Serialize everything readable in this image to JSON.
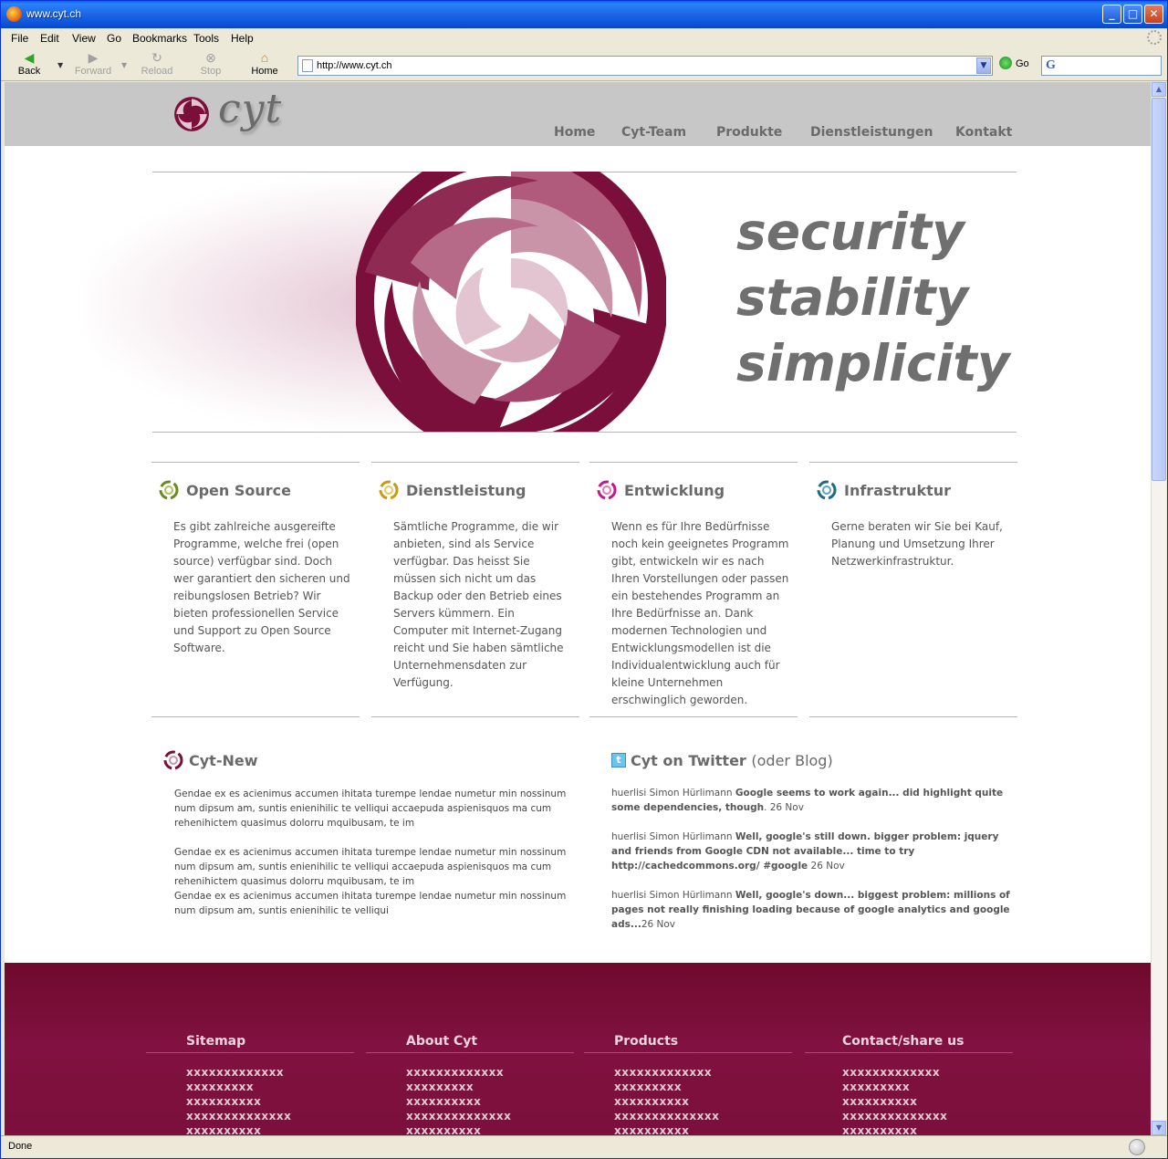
{
  "window": {
    "title": "www.cyt.ch"
  },
  "menu": [
    "File",
    "Edit",
    "View",
    "Go",
    "Bookmarks",
    "Tools",
    "Help"
  ],
  "toolbar": {
    "back": "Back",
    "forward": "Forward",
    "reload": "Reload",
    "stop": "Stop",
    "home": "Home",
    "go": "Go"
  },
  "address": {
    "url": "http://www.cyt.ch"
  },
  "status": {
    "text": "Done"
  },
  "site": {
    "logo_text": "cyt",
    "nav": [
      "Home",
      "Cyt-Team",
      "Produkte",
      "Dienstleistungen",
      "Kontakt"
    ],
    "tagline": [
      "security",
      "stability",
      "simplicity"
    ],
    "colors": {
      "brand": "#7b0f3b",
      "header_bg": "#c7c7c7",
      "text_gray": "#6a6a6a"
    },
    "services": [
      {
        "title": "Open Source",
        "icon": "green-swirl-icon",
        "color": "#6a8a1e",
        "text": "Es gibt zahlreiche ausgereifte Programme, welche frei (open source) verfügbar sind. Doch wer garantiert den sicheren und reibungslosen Betrieb? Wir bieten professionellen Service und Support zu Open Source Software."
      },
      {
        "title": "Dienstleistung",
        "icon": "yellow-swirl-icon",
        "color": "#c89a10",
        "text": "Sämtliche Programme, die wir anbieten, sind als Service verfügbar. Das heisst Sie müssen sich nicht um das Backup oder den Betrieb eines Servers kümmern. Ein Computer mit Internet-Zugang reicht und Sie haben sämtliche Unternehmensdaten zur Verfügung."
      },
      {
        "title": "Entwicklung",
        "icon": "magenta-swirl-icon",
        "color": "#c2188a",
        "text": "Wenn es für Ihre Bedürfnisse noch kein geeignetes Programm gibt, entwickeln wir es nach Ihren Vorstellungen oder passen ein bestehendes Programm an Ihre Bedürfnisse an. Dank modernen Technologien und Entwicklungsmodellen ist die Individualentwicklung auch für kleine Unternehmen erschwinglich geworden."
      },
      {
        "title": "Infrastruktur",
        "icon": "teal-swirl-icon",
        "color": "#1e6a86",
        "text": "Gerne beraten wir Sie bei Kauf, Planung und Umsetzung Ihrer Netzwerkinfrastruktur."
      }
    ],
    "news": {
      "title": "Cyt-New",
      "paragraphs": [
        "Gendae ex es acienimus accumen ihitata turempe lendae numetur min nossinum num dipsum am, suntis enienihilic te velliqui accaepuda aspienisquos ma cum rehenihictem quasimus dolorru mquibusam, te im",
        "Gendae ex es acienimus accumen ihitata turempe lendae numetur min nossinum num dipsum am, suntis enienihilic te velliqui accaepuda aspienisquos ma cum rehenihictem quasimus dolorru mquibusam, te im",
        "Gendae ex es acienimus accumen ihitata turempe lendae numetur min nossinum num dipsum am, suntis enienihilic te velliqui"
      ]
    },
    "twitter": {
      "title": "Cyt on Twitter",
      "subtitle": "(oder Blog)",
      "tweets": [
        {
          "user": "huerlisi Simon Hürlimann",
          "text": "Google seems to work again... did highlight quite some dependencies, though",
          "date": ". 26 Nov"
        },
        {
          "user": "huerlisi Simon Hürlimann",
          "text": "Well, google's still down. bigger problem: jquery and friends from Google CDN not available... time to try http://cachedcommons.org/ #google",
          "date": " 26 Nov"
        },
        {
          "user": "huerlisi Simon Hürlimann",
          "text": "Well, google's down... biggest problem: millions of pages not really finishing loading because of google analytics and google ads...",
          "date": "26 Nov"
        }
      ]
    },
    "footer": [
      {
        "title": "Sitemap",
        "items": [
          "xxxxxxxxxxxxx",
          "xxxxxxxxx",
          "xxxxxxxxxx",
          "xxxxxxxxxxxxxx",
          "xxxxxxxxxx"
        ]
      },
      {
        "title": "About Cyt",
        "items": [
          "xxxxxxxxxxxxx",
          "xxxxxxxxx",
          "xxxxxxxxxx",
          "xxxxxxxxxxxxxx",
          "xxxxxxxxxx"
        ]
      },
      {
        "title": "Products",
        "items": [
          "xxxxxxxxxxxxx",
          "xxxxxxxxx",
          "xxxxxxxxxx",
          "xxxxxxxxxxxxxx",
          "xxxxxxxxxx"
        ]
      },
      {
        "title": "Contact/share us",
        "items": [
          "xxxxxxxxxxxxx",
          "xxxxxxxxx",
          "xxxxxxxxxx",
          "xxxxxxxxxxxxxx",
          "xxxxxxxxxx"
        ]
      }
    ]
  }
}
